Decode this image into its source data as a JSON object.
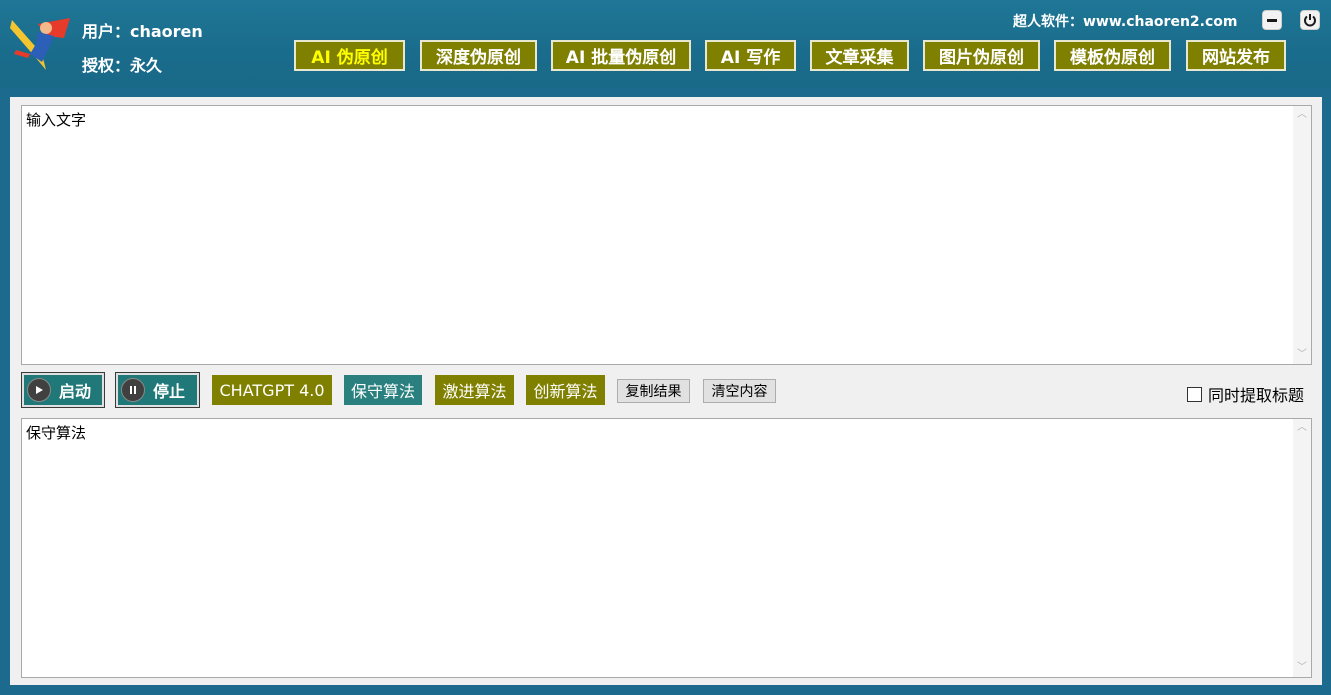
{
  "header": {
    "user_text": "用户：chaoren",
    "auth_text": "授权：永久",
    "site_text": "超人软件：www.chaoren2.com",
    "nav": [
      {
        "label": "AI 伪原创",
        "active": true
      },
      {
        "label": "深度伪原创"
      },
      {
        "label": "AI 批量伪原创"
      },
      {
        "label": "AI 写作"
      },
      {
        "label": "文章采集"
      },
      {
        "label": "图片伪原创"
      },
      {
        "label": "模板伪原创"
      },
      {
        "label": "网站发布"
      }
    ]
  },
  "input_box": {
    "text": "输入文字"
  },
  "toolbar": {
    "start_label": "启动",
    "stop_label": "停止",
    "model_label": "CHATGPT 4.0",
    "algo_conservative": "保守算法",
    "algo_aggressive": "激进算法",
    "algo_innovative": "创新算法",
    "copy_label": "复制结果",
    "clear_label": "清空内容",
    "extract_title_label": "同时提取标题"
  },
  "output_box": {
    "text": "保守算法"
  },
  "colors": {
    "header_bg": "#1a6c8c",
    "nav_bg": "#7f7f00",
    "active_text": "#ffff00",
    "teal": "#207878"
  }
}
